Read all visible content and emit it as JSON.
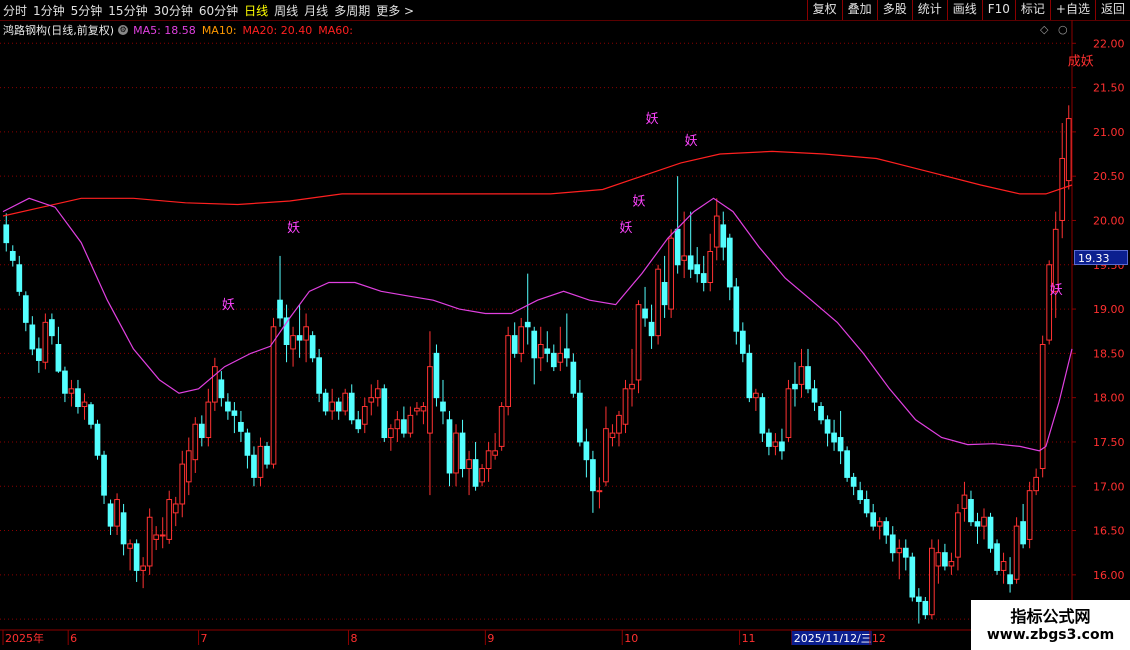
{
  "toolbar": {
    "periods": [
      "分时",
      "1分钟",
      "5分钟",
      "15分钟",
      "30分钟",
      "60分钟",
      "日线",
      "周线",
      "月线",
      "多周期",
      "更多 >"
    ],
    "active_period": "日线",
    "actions": [
      "复权",
      "叠加",
      "多股",
      "统计",
      "画线",
      "F10",
      "标记",
      "+自选",
      "返回"
    ]
  },
  "info": {
    "title": "鸿路钢构(日线,前复权)",
    "ma5": "MA5: 18.58",
    "ma10": "MA10:",
    "ma20": "MA20: 20.40",
    "ma60": "MA60:"
  },
  "colors": {
    "up": "#ff3232",
    "down": "#54ffff",
    "ma5": "#e040e0",
    "ma20": "#ff2020",
    "grid": "#8b0000",
    "signal": "#ff44ff",
    "cheng": "#ff3030"
  },
  "current_price_label": "19.33",
  "watermark": {
    "line1": "指标公式网",
    "line2": "www.zbgs3.com"
  },
  "chart_data": {
    "type": "candlestick",
    "title": "鸿路钢构(日线,前复权)",
    "y_ticks": [
      22.0,
      21.5,
      21.0,
      20.5,
      20.0,
      19.5,
      19.0,
      18.5,
      18.0,
      17.5,
      17.0,
      16.5,
      16.0,
      15.5
    ],
    "ylim": [
      15.4,
      22.15
    ],
    "x_labels": [
      {
        "label": "2025年",
        "index": 0
      },
      {
        "label": "6",
        "index": 10
      },
      {
        "label": "7",
        "index": 30
      },
      {
        "label": "8",
        "index": 53
      },
      {
        "label": "9",
        "index": 74
      },
      {
        "label": "10",
        "index": 95
      },
      {
        "label": "11",
        "index": 113
      },
      {
        "label": "2025/11/12/三",
        "index": 121
      },
      {
        "label": "12",
        "index": 133
      }
    ],
    "candles": [
      [
        19.95,
        20.08,
        19.65,
        19.75
      ],
      [
        19.65,
        19.72,
        19.48,
        19.55
      ],
      [
        19.5,
        19.6,
        19.15,
        19.2
      ],
      [
        19.15,
        19.2,
        18.75,
        18.85
      ],
      [
        18.82,
        18.92,
        18.48,
        18.55
      ],
      [
        18.55,
        18.68,
        18.28,
        18.42
      ],
      [
        18.4,
        18.95,
        18.32,
        18.85
      ],
      [
        18.88,
        18.95,
        18.6,
        18.7
      ],
      [
        18.6,
        18.8,
        18.28,
        18.3
      ],
      [
        18.3,
        18.35,
        17.95,
        18.05
      ],
      [
        18.05,
        18.2,
        17.9,
        18.1
      ],
      [
        18.1,
        18.2,
        17.82,
        17.9
      ],
      [
        17.9,
        18.05,
        17.75,
        17.95
      ],
      [
        17.92,
        17.95,
        17.65,
        17.7
      ],
      [
        17.7,
        17.75,
        17.3,
        17.35
      ],
      [
        17.35,
        17.4,
        16.8,
        16.9
      ],
      [
        16.8,
        16.85,
        16.45,
        16.55
      ],
      [
        16.55,
        16.92,
        16.45,
        16.85
      ],
      [
        16.7,
        16.8,
        16.22,
        16.35
      ],
      [
        16.3,
        16.4,
        16.05,
        16.35
      ],
      [
        16.35,
        16.4,
        15.92,
        16.05
      ],
      [
        16.05,
        16.2,
        15.85,
        16.1
      ],
      [
        16.1,
        16.75,
        16.0,
        16.65
      ],
      [
        16.4,
        16.55,
        16.28,
        16.45
      ],
      [
        16.45,
        16.65,
        16.3,
        16.45
      ],
      [
        16.4,
        16.95,
        16.35,
        16.85
      ],
      [
        16.7,
        16.88,
        16.55,
        16.8
      ],
      [
        16.8,
        17.4,
        16.65,
        17.25
      ],
      [
        17.05,
        17.55,
        16.9,
        17.4
      ],
      [
        17.3,
        17.78,
        17.15,
        17.7
      ],
      [
        17.7,
        17.8,
        17.45,
        17.55
      ],
      [
        17.55,
        18.1,
        17.45,
        17.95
      ],
      [
        17.95,
        18.45,
        17.85,
        18.35
      ],
      [
        18.2,
        18.3,
        17.9,
        18.0
      ],
      [
        17.95,
        18.05,
        17.75,
        17.85
      ],
      [
        17.85,
        17.95,
        17.6,
        17.8
      ],
      [
        17.72,
        17.85,
        17.5,
        17.62
      ],
      [
        17.6,
        17.65,
        17.2,
        17.35
      ],
      [
        17.35,
        17.45,
        17.0,
        17.1
      ],
      [
        17.1,
        17.55,
        17.0,
        17.45
      ],
      [
        17.45,
        17.5,
        17.2,
        17.25
      ],
      [
        17.25,
        18.9,
        17.2,
        18.8
      ],
      [
        19.1,
        19.6,
        18.8,
        18.9
      ],
      [
        18.9,
        19.05,
        18.4,
        18.6
      ],
      [
        18.55,
        18.8,
        18.35,
        18.7
      ],
      [
        18.7,
        19.05,
        18.45,
        18.65
      ],
      [
        18.65,
        18.95,
        18.4,
        18.8
      ],
      [
        18.7,
        18.75,
        18.4,
        18.45
      ],
      [
        18.45,
        18.55,
        17.95,
        18.05
      ],
      [
        18.05,
        18.1,
        17.8,
        17.85
      ],
      [
        17.85,
        18.1,
        17.75,
        17.95
      ],
      [
        17.95,
        18.0,
        17.75,
        17.85
      ],
      [
        17.85,
        18.1,
        17.8,
        18.05
      ],
      [
        18.05,
        18.15,
        17.7,
        17.75
      ],
      [
        17.75,
        17.85,
        17.6,
        17.65
      ],
      [
        17.7,
        18.0,
        17.6,
        17.9
      ],
      [
        17.95,
        18.15,
        17.8,
        18.0
      ],
      [
        18.0,
        18.2,
        17.9,
        18.1
      ],
      [
        18.1,
        18.15,
        17.5,
        17.55
      ],
      [
        17.55,
        17.7,
        17.4,
        17.65
      ],
      [
        17.65,
        17.85,
        17.5,
        17.75
      ],
      [
        17.75,
        17.9,
        17.55,
        17.6
      ],
      [
        17.6,
        17.9,
        17.55,
        17.8
      ],
      [
        17.85,
        17.95,
        17.8,
        17.88
      ],
      [
        17.85,
        17.95,
        17.7,
        17.9
      ],
      [
        17.6,
        18.75,
        16.9,
        18.35
      ],
      [
        18.5,
        18.6,
        17.9,
        18.0
      ],
      [
        17.95,
        18.2,
        17.7,
        17.85
      ],
      [
        17.75,
        17.85,
        17.0,
        17.15
      ],
      [
        17.15,
        17.7,
        17.0,
        17.6
      ],
      [
        17.6,
        17.75,
        17.1,
        17.2
      ],
      [
        17.2,
        17.4,
        16.9,
        17.3
      ],
      [
        17.3,
        17.5,
        16.95,
        17.0
      ],
      [
        17.05,
        17.25,
        17.0,
        17.2
      ],
      [
        17.2,
        17.5,
        17.05,
        17.4
      ],
      [
        17.35,
        17.6,
        17.3,
        17.4
      ],
      [
        17.45,
        17.95,
        17.4,
        17.9
      ],
      [
        17.9,
        18.8,
        17.8,
        18.7
      ],
      [
        18.7,
        18.85,
        18.45,
        18.5
      ],
      [
        18.5,
        18.9,
        18.4,
        18.8
      ],
      [
        18.85,
        19.4,
        18.6,
        18.8
      ],
      [
        18.75,
        18.8,
        18.15,
        18.45
      ],
      [
        18.45,
        18.8,
        18.3,
        18.6
      ],
      [
        18.55,
        18.75,
        18.4,
        18.5
      ],
      [
        18.5,
        18.6,
        18.3,
        18.35
      ],
      [
        18.4,
        18.8,
        18.3,
        18.5
      ],
      [
        18.55,
        18.95,
        18.35,
        18.45
      ],
      [
        18.4,
        18.5,
        18.0,
        18.05
      ],
      [
        18.05,
        18.2,
        17.45,
        17.5
      ],
      [
        17.5,
        17.65,
        17.1,
        17.3
      ],
      [
        17.3,
        17.4,
        16.7,
        16.95
      ],
      [
        16.95,
        17.1,
        16.75,
        16.95
      ],
      [
        17.05,
        17.9,
        17.0,
        17.65
      ],
      [
        17.55,
        17.7,
        17.45,
        17.6
      ],
      [
        17.6,
        17.85,
        17.45,
        17.8
      ],
      [
        17.7,
        18.2,
        17.6,
        18.1
      ],
      [
        18.1,
        18.55,
        17.9,
        18.15
      ],
      [
        18.2,
        19.1,
        18.05,
        19.05
      ],
      [
        19.0,
        19.25,
        18.8,
        18.9
      ],
      [
        18.85,
        19.05,
        18.55,
        18.7
      ],
      [
        18.7,
        19.5,
        18.6,
        19.45
      ],
      [
        19.3,
        19.6,
        18.9,
        19.05
      ],
      [
        19.0,
        19.9,
        18.9,
        19.8
      ],
      [
        19.9,
        20.5,
        19.4,
        19.5
      ],
      [
        19.55,
        20.1,
        19.35,
        19.6
      ],
      [
        19.6,
        20.1,
        19.35,
        19.45
      ],
      [
        19.5,
        19.7,
        19.3,
        19.4
      ],
      [
        19.4,
        19.6,
        19.2,
        19.3
      ],
      [
        19.3,
        19.85,
        19.2,
        19.65
      ],
      [
        19.7,
        20.25,
        19.55,
        20.05
      ],
      [
        19.95,
        20.1,
        19.55,
        19.7
      ],
      [
        19.8,
        19.85,
        19.1,
        19.25
      ],
      [
        19.25,
        19.35,
        18.6,
        18.75
      ],
      [
        18.75,
        18.85,
        18.4,
        18.5
      ],
      [
        18.5,
        18.6,
        17.95,
        18.0
      ],
      [
        18.0,
        18.1,
        17.85,
        18.05
      ],
      [
        18.0,
        18.05,
        17.5,
        17.6
      ],
      [
        17.6,
        17.65,
        17.35,
        17.45
      ],
      [
        17.45,
        17.6,
        17.35,
        17.5
      ],
      [
        17.5,
        17.65,
        17.3,
        17.4
      ],
      [
        17.55,
        18.2,
        17.5,
        18.1
      ],
      [
        18.15,
        18.4,
        17.9,
        18.1
      ],
      [
        18.15,
        18.55,
        18.0,
        18.35
      ],
      [
        18.35,
        18.55,
        18.05,
        18.1
      ],
      [
        18.1,
        18.2,
        17.85,
        17.95
      ],
      [
        17.9,
        17.95,
        17.7,
        17.75
      ],
      [
        17.75,
        17.8,
        17.45,
        17.6
      ],
      [
        17.6,
        17.75,
        17.4,
        17.5
      ],
      [
        17.55,
        17.85,
        17.25,
        17.4
      ],
      [
        17.4,
        17.45,
        17.05,
        17.1
      ],
      [
        17.1,
        17.15,
        16.9,
        17.0
      ],
      [
        16.95,
        17.05,
        16.8,
        16.85
      ],
      [
        16.85,
        16.95,
        16.65,
        16.7
      ],
      [
        16.7,
        16.8,
        16.5,
        16.55
      ],
      [
        16.55,
        16.65,
        16.4,
        16.6
      ],
      [
        16.6,
        16.65,
        16.35,
        16.45
      ],
      [
        16.45,
        16.55,
        16.15,
        16.25
      ],
      [
        16.25,
        16.4,
        15.95,
        16.3
      ],
      [
        16.3,
        16.4,
        16.05,
        16.2
      ],
      [
        16.2,
        16.25,
        15.7,
        15.75
      ],
      [
        15.75,
        15.85,
        15.45,
        15.7
      ],
      [
        15.7,
        15.75,
        15.5,
        15.55
      ],
      [
        15.55,
        16.4,
        15.5,
        16.3
      ],
      [
        16.1,
        16.4,
        15.9,
        16.25
      ],
      [
        16.25,
        16.35,
        16.05,
        16.1
      ],
      [
        16.1,
        16.25,
        16.0,
        16.15
      ],
      [
        16.2,
        16.8,
        16.05,
        16.7
      ],
      [
        16.75,
        17.05,
        16.6,
        16.9
      ],
      [
        16.85,
        16.95,
        16.55,
        16.6
      ],
      [
        16.6,
        16.7,
        16.35,
        16.55
      ],
      [
        16.55,
        16.75,
        16.4,
        16.65
      ],
      [
        16.65,
        16.7,
        16.25,
        16.3
      ],
      [
        16.35,
        16.4,
        16.0,
        16.05
      ],
      [
        16.05,
        16.25,
        15.9,
        16.15
      ],
      [
        16.0,
        16.2,
        15.8,
        15.9
      ],
      [
        15.95,
        16.65,
        15.9,
        16.55
      ],
      [
        16.6,
        16.8,
        16.3,
        16.35
      ],
      [
        16.4,
        17.05,
        16.3,
        16.95
      ],
      [
        16.95,
        17.2,
        16.9,
        17.1
      ],
      [
        17.2,
        18.7,
        17.1,
        18.6
      ],
      [
        18.65,
        19.55,
        18.6,
        19.5
      ],
      [
        19.2,
        20.1,
        18.9,
        19.9
      ],
      [
        20.0,
        21.1,
        19.8,
        20.7
      ],
      [
        20.45,
        21.3,
        20.35,
        21.15
      ]
    ],
    "ma5_curve": [
      [
        0,
        20.1
      ],
      [
        4,
        20.25
      ],
      [
        8,
        20.15
      ],
      [
        12,
        19.75
      ],
      [
        16,
        19.1
      ],
      [
        20,
        18.55
      ],
      [
        24,
        18.2
      ],
      [
        27,
        18.05
      ],
      [
        30,
        18.1
      ],
      [
        34,
        18.35
      ],
      [
        38,
        18.5
      ],
      [
        41,
        18.58
      ],
      [
        44,
        18.9
      ],
      [
        47,
        19.2
      ],
      [
        50,
        19.3
      ],
      [
        54,
        19.3
      ],
      [
        58,
        19.2
      ],
      [
        62,
        19.15
      ],
      [
        66,
        19.1
      ],
      [
        70,
        19.0
      ],
      [
        74,
        18.95
      ],
      [
        78,
        18.95
      ],
      [
        82,
        19.1
      ],
      [
        86,
        19.2
      ],
      [
        90,
        19.1
      ],
      [
        94,
        19.05
      ],
      [
        98,
        19.4
      ],
      [
        102,
        19.8
      ],
      [
        106,
        20.1
      ],
      [
        109,
        20.25
      ],
      [
        112,
        20.1
      ],
      [
        116,
        19.7
      ],
      [
        120,
        19.35
      ],
      [
        124,
        19.1
      ],
      [
        128,
        18.85
      ],
      [
        132,
        18.5
      ],
      [
        136,
        18.1
      ],
      [
        140,
        17.75
      ],
      [
        144,
        17.55
      ],
      [
        148,
        17.47
      ],
      [
        152,
        17.48
      ],
      [
        156,
        17.45
      ],
      [
        159,
        17.4
      ],
      [
        160,
        17.45
      ],
      [
        161,
        17.7
      ],
      [
        162,
        17.95
      ],
      [
        163,
        18.25
      ],
      [
        164,
        18.55
      ]
    ],
    "ma20_curve": [
      [
        0,
        20.05
      ],
      [
        6,
        20.15
      ],
      [
        12,
        20.25
      ],
      [
        20,
        20.25
      ],
      [
        28,
        20.2
      ],
      [
        36,
        20.18
      ],
      [
        44,
        20.22
      ],
      [
        52,
        20.3
      ],
      [
        60,
        20.3
      ],
      [
        68,
        20.3
      ],
      [
        76,
        20.3
      ],
      [
        84,
        20.3
      ],
      [
        92,
        20.35
      ],
      [
        98,
        20.5
      ],
      [
        104,
        20.65
      ],
      [
        110,
        20.75
      ],
      [
        118,
        20.78
      ],
      [
        126,
        20.75
      ],
      [
        134,
        20.7
      ],
      [
        142,
        20.55
      ],
      [
        150,
        20.4
      ],
      [
        156,
        20.3
      ],
      [
        160,
        20.3
      ],
      [
        164,
        20.4
      ]
    ],
    "signals": [
      {
        "label": "妖",
        "index": 34,
        "price": 19.0
      },
      {
        "label": "妖",
        "index": 44,
        "price": 19.87
      },
      {
        "label": "妖",
        "index": 95,
        "price": 19.87
      },
      {
        "label": "妖",
        "index": 97,
        "price": 20.17
      },
      {
        "label": "妖",
        "index": 99,
        "price": 21.1
      },
      {
        "label": "妖",
        "index": 105,
        "price": 20.85
      },
      {
        "label": "妖",
        "index": 161,
        "price": 19.17
      },
      {
        "label": "成妖",
        "index": 161,
        "price": 21.75
      }
    ]
  }
}
